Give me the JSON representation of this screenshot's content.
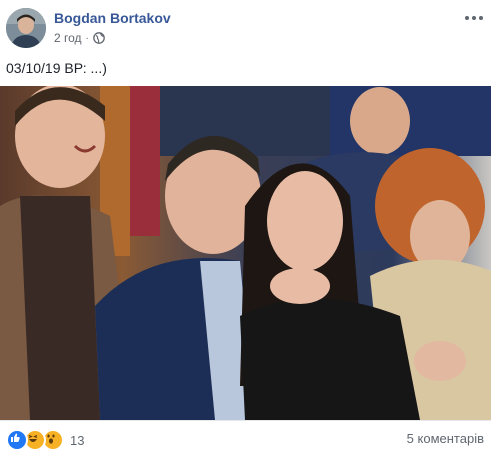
{
  "post": {
    "author": "Bogdan Bortakov",
    "time": "2 год",
    "separator": "·",
    "caption": "03/10/19 ВР: ...)",
    "reaction_count": "13",
    "comments_label": "5 коментарів",
    "reactions": [
      "like",
      "haha",
      "wow"
    ]
  },
  "icons": {
    "privacy": "globe-icon",
    "menu": "more-options-icon"
  },
  "colors": {
    "author_link": "#385898",
    "like_blue": "#2078f4",
    "emoji_yellow": "#f7b125",
    "meta_gray": "#616770"
  }
}
